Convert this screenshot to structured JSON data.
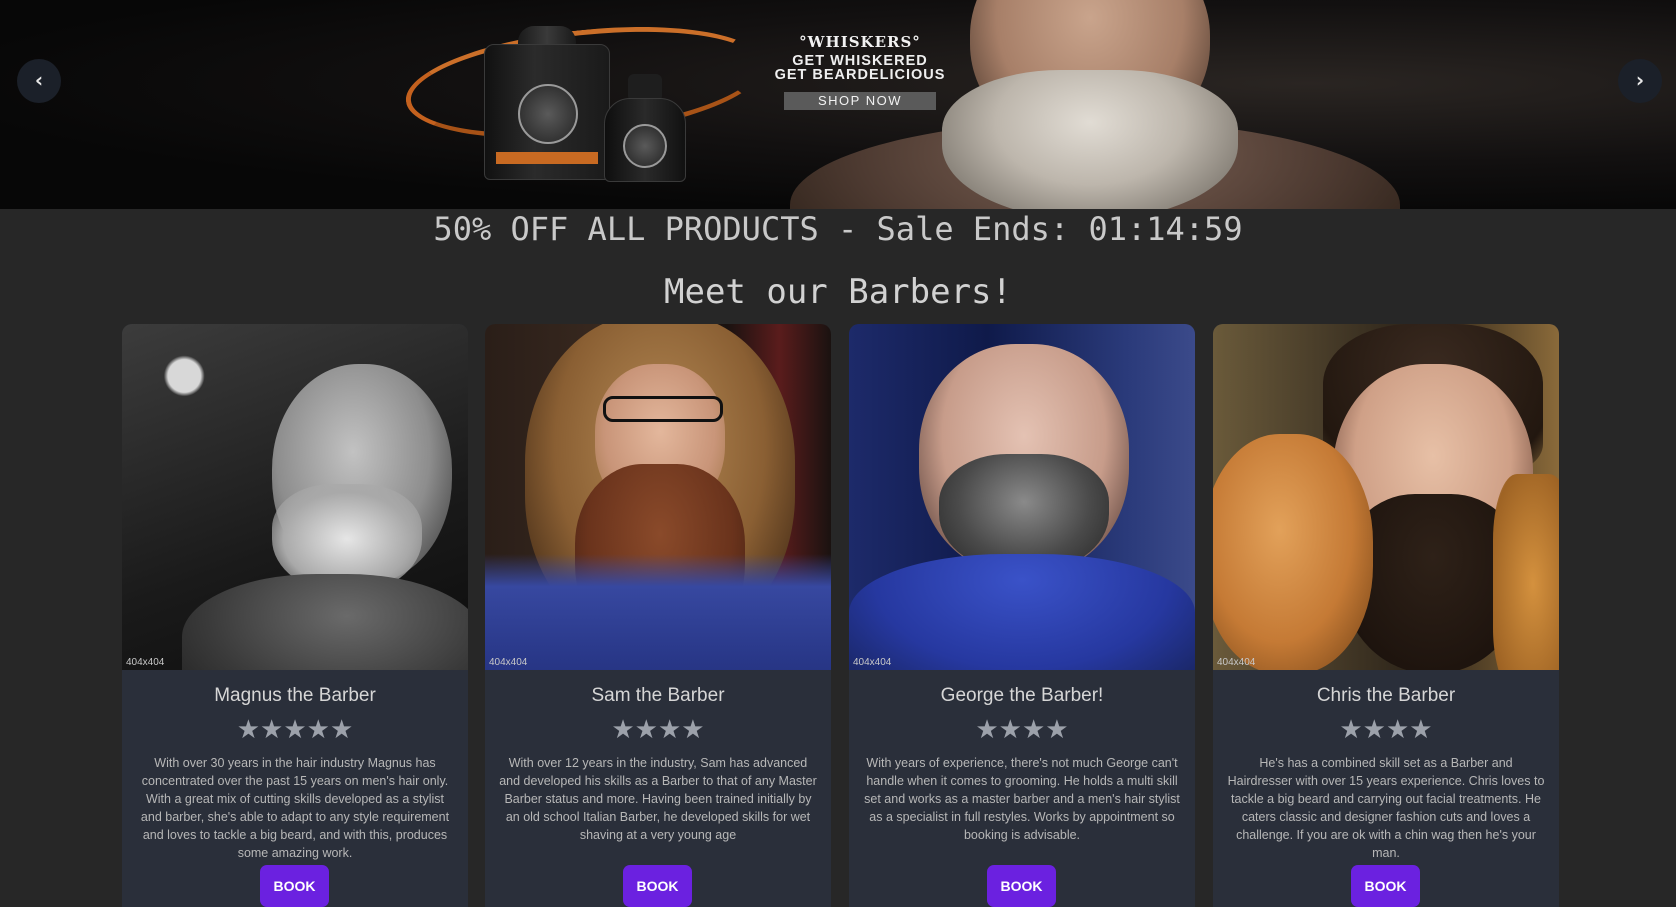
{
  "hero": {
    "prev_icon": "‹",
    "next_icon": "›",
    "ad": {
      "brand": "°WHISKERS°",
      "line1": "GET WHISKERED",
      "line2": "GET BEARDELICIOUS",
      "cta": "SHOP NOW"
    }
  },
  "sale": {
    "text": "50% OFF ALL PRODUCTS - Sale Ends: 01:14:59"
  },
  "section_title": "Meet our Barbers!",
  "barbers": [
    {
      "name": "Magnus the Barber",
      "rating": 5,
      "stars": "★★★★★",
      "image_label": "404x404",
      "bio": "With over 30 years in the hair industry Magnus has concentrated over the past 15 years on men's hair only. With a great mix of cutting skills developed as a stylist and barber, she's able to adapt to any style requirement and loves to tackle a big beard, and with this, produces some amazing work.",
      "book_label": "BOOK"
    },
    {
      "name": "Sam the Barber",
      "rating": 4,
      "stars": "★★★★",
      "image_label": "404x404",
      "bio": "With over 12 years in the industry, Sam has advanced and developed his skills as a Barber to that of any Master Barber status and more. Having been trained initially by an old school Italian Barber, he developed skills for wet shaving at a very young age",
      "book_label": "BOOK"
    },
    {
      "name": "George the Barber!",
      "rating": 4,
      "stars": "★★★★",
      "image_label": "404x404",
      "bio": "With years of experience, there's not much George can't handle when it comes to grooming. He holds a multi skill set and works as a master barber and a men's hair stylist as a specialist in full restyles. Works by appointment so booking is advisable.",
      "book_label": "BOOK"
    },
    {
      "name": "Chris the Barber",
      "rating": 4,
      "stars": "★★★★",
      "image_label": "404x404",
      "bio": "He's has a combined skill set as a Barber and Hairdresser with over 15 years experience. Chris loves to tackle a big beard and carrying out facial treatments. He caters classic and designer fashion cuts and loves a challenge. If you are ok with a chin wag then he's your man.",
      "book_label": "BOOK"
    }
  ],
  "colors": {
    "background": "#272727",
    "card": "#2a2f3a",
    "book_button": "#6b21e0",
    "accent_orange": "#e07a2c"
  }
}
